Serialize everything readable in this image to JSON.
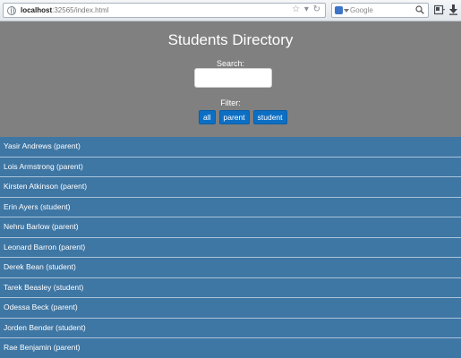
{
  "browser": {
    "url_host": "localhost",
    "url_rest": ":32565/index.html",
    "search_placeholder": "Google"
  },
  "header": {
    "title": "Students Directory",
    "search_label": "Search:",
    "search_value": "",
    "filter_label": "Filter:"
  },
  "filters": [
    {
      "label": "all"
    },
    {
      "label": "parent"
    },
    {
      "label": "student"
    }
  ],
  "students": [
    {
      "label": "Yasir Andrews (parent)"
    },
    {
      "label": "Lois Armstrong (parent)"
    },
    {
      "label": "Kirsten Atkinson (parent)"
    },
    {
      "label": "Erin Ayers (student)"
    },
    {
      "label": "Nehru Barlow (parent)"
    },
    {
      "label": "Leonard Barron (parent)"
    },
    {
      "label": "Derek Bean (student)"
    },
    {
      "label": "Tarek Beasley (student)"
    },
    {
      "label": "Odessa Beck (parent)"
    },
    {
      "label": "Jorden Bender (student)"
    },
    {
      "label": "Rae Benjamin (parent)"
    }
  ],
  "colors": {
    "header_bg": "#808080",
    "list_bg": "#3e76a4",
    "button_bg": "#0d6fc4"
  }
}
